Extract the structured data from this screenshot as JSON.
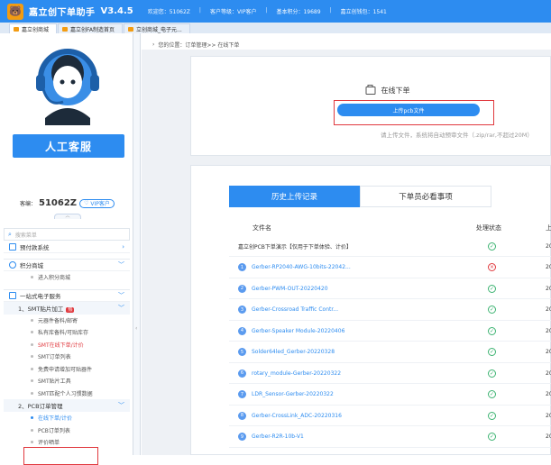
{
  "titlebar": {
    "app_name": "嘉立创下单助手",
    "version": "V3.4.5",
    "info": [
      "欢迎您：51062Z",
      "客户等级：VIP客户",
      "基本积分：19689",
      "嘉立创钱包：1541"
    ]
  },
  "tabs": [
    "嘉立创商城",
    "嘉立创FA制造首页",
    "立创商城_电子元..."
  ],
  "sidebar": {
    "service_button": "人工客服",
    "account_label": "客编：",
    "account_number": "51062Z",
    "vip": "VIP客户",
    "search_placeholder": "搜索菜单",
    "prepay": "预付款系统",
    "points_mall": "积分商城",
    "points_sub": "进入积分商城",
    "one_stop": "一站式电子服务",
    "smt_section": "1、SMT贴片加工",
    "hot_badge": "热",
    "smt_items": [
      "元器件备料/邮寄",
      "私有库备料/可贴库存",
      "SMT在线下单/计价",
      "SMT订单列表",
      "免费申请增加可贴器件",
      "SMT贴片工具",
      "SMT匹配个人习惯数据"
    ],
    "pcb_section": "2、PCB订单管理",
    "pcb_items": [
      "在线下单/计价",
      "PCB订单列表",
      "评价晒单"
    ]
  },
  "breadcrumb": "您的位置：订单管理>> 在线下单",
  "upload": {
    "title": "在线下单",
    "button": "上传pcb文件",
    "hint": "请上传文件，系统将自动预审文件（.zip/rar,不超过20M）"
  },
  "history": {
    "tabs": [
      "历史上传记录",
      "下单员必看事项"
    ],
    "headers": [
      "文件名",
      "处理状态",
      "上"
    ],
    "rows": [
      {
        "name": "嘉立创PCB下单演示【仅用于下单体验、计价】",
        "numbered": false,
        "status": "ok",
        "tail": "20"
      },
      {
        "name": "Gerber-RP2040-AWG-10bits-22042...",
        "numbered": true,
        "n": "1",
        "status": "err",
        "tail": "20"
      },
      {
        "name": "Gerber-PWM-OUT-20220420",
        "numbered": true,
        "n": "2",
        "status": "ok",
        "tail": "20"
      },
      {
        "name": "Gerber-Crossroad Traffic Contr...",
        "numbered": true,
        "n": "3",
        "status": "ok",
        "tail": "20"
      },
      {
        "name": "Gerber-Speaker Module-20220406",
        "numbered": true,
        "n": "4",
        "status": "ok",
        "tail": "20"
      },
      {
        "name": "Solder64led_Gerber-20220328",
        "numbered": true,
        "n": "5",
        "status": "ok",
        "tail": "20"
      },
      {
        "name": "rotary_module-Gerber-20220322",
        "numbered": true,
        "n": "6",
        "status": "ok",
        "tail": "20"
      },
      {
        "name": "LDR_Sensor-Gerber-20220322",
        "numbered": true,
        "n": "7",
        "status": "ok",
        "tail": "20"
      },
      {
        "name": "Gerber-CrossLink_ADC-20220316",
        "numbered": true,
        "n": "8",
        "status": "ok",
        "tail": "20"
      },
      {
        "name": "Gerber-R2R-10b-V1",
        "numbered": true,
        "n": "9",
        "status": "ok",
        "tail": "20"
      }
    ]
  },
  "colors": {
    "primary": "#2d8cf0",
    "red": "#e0393e",
    "green": "#3cb371"
  }
}
